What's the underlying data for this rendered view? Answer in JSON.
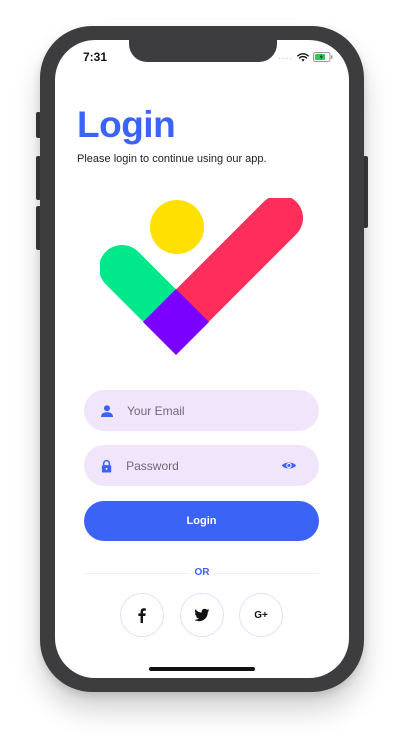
{
  "status_bar": {
    "time": "7:31",
    "signal_icon": "signal-dots-icon",
    "wifi_icon": "wifi-icon",
    "battery_icon": "battery-icon"
  },
  "header": {
    "title": "Login",
    "subtitle": "Please login to continue using our app."
  },
  "hero": {
    "icon": "checkmark-logo",
    "colors": {
      "circle": "#FFE000",
      "left_bar": "#00E88A",
      "right_bar": "#FF2D5A",
      "overlap": "#7A00FF"
    }
  },
  "form": {
    "email": {
      "placeholder": "Your Email",
      "value": "",
      "icon": "user-icon"
    },
    "password": {
      "placeholder": "Password",
      "value": "",
      "icon": "lock-icon",
      "toggle_icon": "eye-icon"
    },
    "login_label": "Login"
  },
  "divider": {
    "label": "OR"
  },
  "social": [
    {
      "name": "facebook",
      "icon": "facebook-icon",
      "label": "f"
    },
    {
      "name": "twitter",
      "icon": "twitter-icon",
      "label": ""
    },
    {
      "name": "google-plus",
      "icon": "google-plus-icon",
      "label": "G+"
    }
  ],
  "theme": {
    "primary": "#3B63F6",
    "field_bg": "#F1E5FB",
    "phone_frame": "#3D3D3F"
  }
}
